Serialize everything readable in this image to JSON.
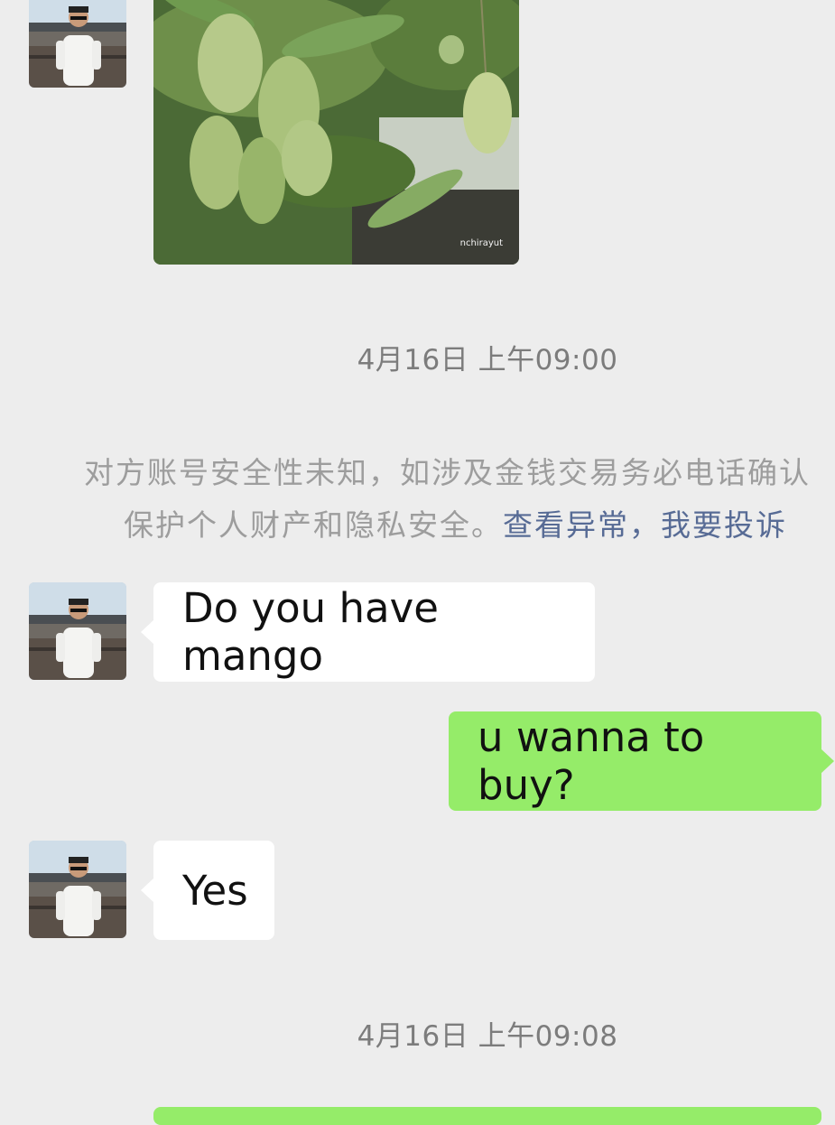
{
  "image_message": {
    "watermark": "nchirayut",
    "subject": "mangoes-on-tree-photo"
  },
  "timestamps": [
    "4月16日 上午09:00",
    "4月16日 上午09:08"
  ],
  "security_notice": {
    "line1": "对方账号安全性未知，如涉及金钱交易务必电话确认",
    "line2_text": "保护个人财产和隐私安全。",
    "link_view": "查看异常",
    "separator": "，",
    "link_report": "我要投诉"
  },
  "messages": [
    {
      "side": "incoming",
      "text": "Do you have mango"
    },
    {
      "side": "outgoing",
      "text": "u wanna to buy?"
    },
    {
      "side": "incoming",
      "text": "Yes"
    }
  ],
  "colors": {
    "background": "#ededed",
    "outgoing_bubble": "#95ec69",
    "incoming_bubble": "#ffffff",
    "link": "#576b95"
  }
}
